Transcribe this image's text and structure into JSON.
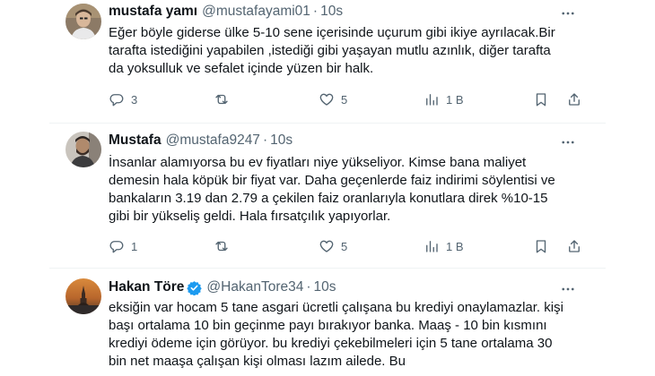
{
  "tweets": [
    {
      "name": "mustafa yamı",
      "handle": "@mustafayami01",
      "dot": "·",
      "time": "10s",
      "verified": false,
      "lines": [
        "Eğer böyle giderse ülke 5-10 sene içerisinde uçurum gibi ikiye ayrılacak.Bir",
        "tarafta istediğini yapabilen ,istediği gibi yaşayan mutlu azınlık, diğer tarafta",
        "da yoksulluk ve sefalet içinde yüzen bir halk."
      ],
      "replies": "3",
      "retweets": "",
      "likes": "5",
      "views": "1 B"
    },
    {
      "name": "Mustafa",
      "handle": "@mustafa9247",
      "dot": "·",
      "time": "10s",
      "verified": false,
      "lines": [
        "İnsanlar alamıyorsa bu ev fiyatları niye yükseliyor. Kimse bana maliyet",
        "demesin hala köpük bir fiyat var. Daha geçenlerde faiz indirimi söylentisi ve",
        "bankaların 3.19 dan 2.79 a çekilen faiz oranlarıyla konutlara direk %10-15",
        "gibi bir yükseliş geldi. Hala fırsatçılık yapıyorlar."
      ],
      "replies": "1",
      "retweets": "",
      "likes": "5",
      "views": "1 B"
    },
    {
      "name": "Hakan Töre",
      "handle": "@HakanTore34",
      "dot": "·",
      "time": "10s",
      "verified": true,
      "lines": [
        "eksiğin var hocam 5 tane asgari ücretli çalışana bu krediyi onaylamazlar. kişi",
        "başı ortalama 10 bin geçinme payı bırakıyor banka. Maaş - 10 bin kısmını",
        "krediyi ödeme için görüyor.  bu krediyi çekebilmeleri için 5 tane ortalama 30",
        "bin net maaşa çalışan kişi olması lazım ailede. Bu"
      ]
    }
  ],
  "icons": {
    "more": "more-horizontal-icon",
    "reply": "reply-icon",
    "retweet": "retweet-icon",
    "like": "heart-icon",
    "views": "views-chart-icon",
    "bookmark": "bookmark-icon",
    "share": "share-icon",
    "verified": "verified-badge-icon"
  },
  "colors": {
    "text": "#0f1419",
    "secondary": "#536471",
    "verified": "#1d9bf0",
    "separator": "#eff3f4"
  }
}
